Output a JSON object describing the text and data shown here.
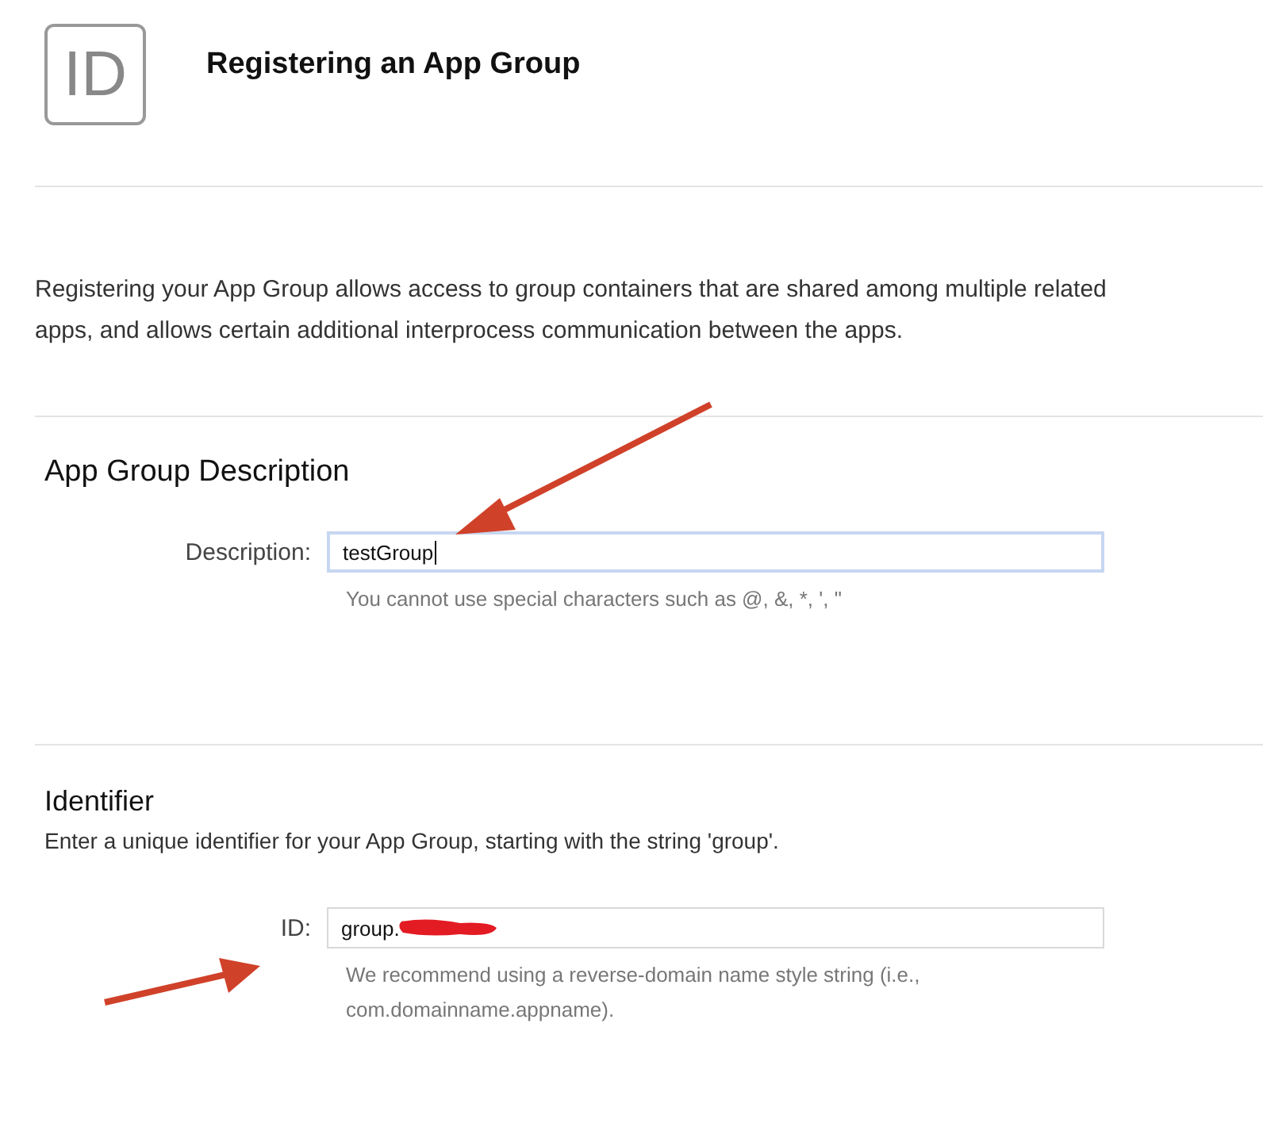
{
  "header": {
    "icon_text": "ID",
    "title": "Registering an App Group"
  },
  "intro": "Registering your App Group allows access to group containers that are shared among multiple related apps, and allows certain additional interprocess communication between the apps.",
  "description_section": {
    "heading": "App Group Description",
    "label": "Description:",
    "value": "testGroup",
    "focused": true,
    "help": "You cannot use special characters such as @, &, *, ', \""
  },
  "identifier_section": {
    "heading": "Identifier",
    "text": "Enter a unique identifier for your App Group, starting with the string 'group'.",
    "label": "ID:",
    "value": "group.",
    "redacted": true,
    "help": "We recommend using a reverse-domain name style string (i.e., com.domainname.appname)."
  }
}
